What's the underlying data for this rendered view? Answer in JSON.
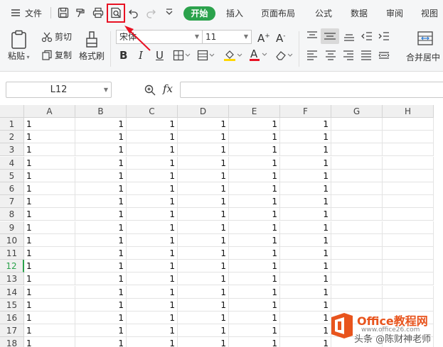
{
  "menu": {
    "file_label": "文件",
    "tabs": [
      "开始",
      "插入",
      "页面布局",
      "公式",
      "数据",
      "审阅",
      "视图"
    ]
  },
  "ribbon": {
    "paste_label": "粘贴",
    "cut_label": "剪切",
    "copy_label": "复制",
    "format_painter_label": "格式刷",
    "font_name": "宋体",
    "font_size": "11",
    "grow_font": "A",
    "shrink_font": "A",
    "bold": "B",
    "italic": "I",
    "underline": "U",
    "font_color_letter": "A",
    "merge_label": "合并居中"
  },
  "formula_bar": {
    "name_box": "L12",
    "fx_label": "fx",
    "value": ""
  },
  "sheet": {
    "columns": [
      "A",
      "B",
      "C",
      "D",
      "E",
      "F",
      "G",
      "H"
    ],
    "rows": [
      "1",
      "2",
      "3",
      "4",
      "5",
      "6",
      "7",
      "8",
      "9",
      "10",
      "11",
      "12",
      "13",
      "14",
      "15",
      "16",
      "17",
      "18"
    ],
    "selected_row": "12",
    "cell_value": "1"
  },
  "watermark": {
    "brand": "Office教程网",
    "url": "www.office26.com",
    "author": "头条 @陈财神老师"
  },
  "colors": {
    "accent": "#2ba24c",
    "highlight": "#e81123",
    "watermark_orange": "#e8541d"
  },
  "icons": [
    "menu-icon",
    "save-icon",
    "format-painter-icon",
    "print-icon",
    "print-preview-icon",
    "undo-icon",
    "redo-icon",
    "customize-icon",
    "paste-icon",
    "scissors-icon",
    "copy-icon",
    "zoom-icon",
    "align-icon",
    "office-logo-icon"
  ]
}
